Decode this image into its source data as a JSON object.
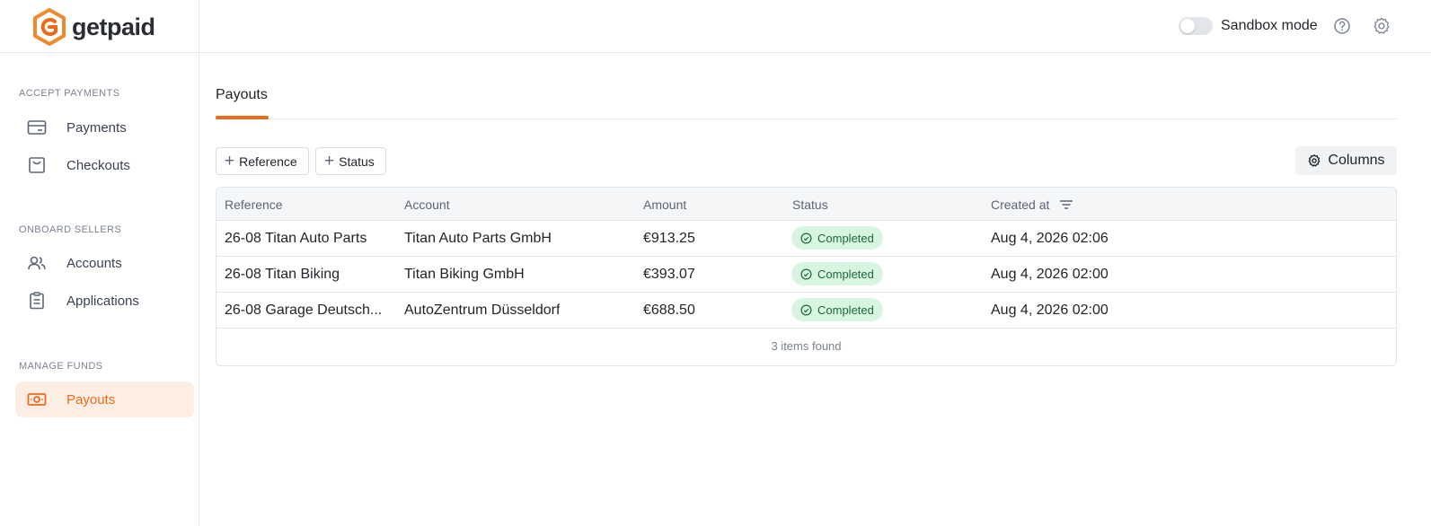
{
  "brand": {
    "name": "getpaid",
    "accent": "#ec6b1a"
  },
  "sidebar": {
    "sections": [
      {
        "label": "ACCEPT PAYMENTS",
        "items": [
          {
            "label": "Payments",
            "icon": "card-icon"
          },
          {
            "label": "Checkouts",
            "icon": "bag-icon"
          }
        ]
      },
      {
        "label": "ONBOARD SELLERS",
        "items": [
          {
            "label": "Accounts",
            "icon": "users-icon"
          },
          {
            "label": "Applications",
            "icon": "clipboard-icon"
          }
        ]
      },
      {
        "label": "MANAGE FUNDS",
        "items": [
          {
            "label": "Payouts",
            "icon": "cash-icon",
            "active": true
          }
        ]
      }
    ]
  },
  "header": {
    "sandbox_label": "Sandbox mode",
    "sandbox_on": false
  },
  "tabs": [
    {
      "label": "Payouts",
      "active": true
    }
  ],
  "filters": {
    "reference_label": "Reference",
    "status_label": "Status",
    "columns_label": "Columns"
  },
  "table": {
    "headers": [
      "Reference",
      "Account",
      "Amount",
      "Status",
      "Created at"
    ],
    "rows": [
      {
        "reference": "26-08 Titan Auto Parts",
        "account": "Titan Auto Parts GmbH",
        "amount": "€913.25",
        "status": "Completed",
        "created": "Aug 4, 2026 02:06"
      },
      {
        "reference": "26-08 Titan Biking",
        "account": "Titan Biking GmbH",
        "amount": "€393.07",
        "status": "Completed",
        "created": "Aug 4, 2026 02:00"
      },
      {
        "reference": "26-08 Garage Deutsch...",
        "account": "AutoZentrum Düsseldorf",
        "amount": "€688.50",
        "status": "Completed",
        "created": "Aug 4, 2026 02:00"
      }
    ],
    "footer": "3 items found"
  }
}
